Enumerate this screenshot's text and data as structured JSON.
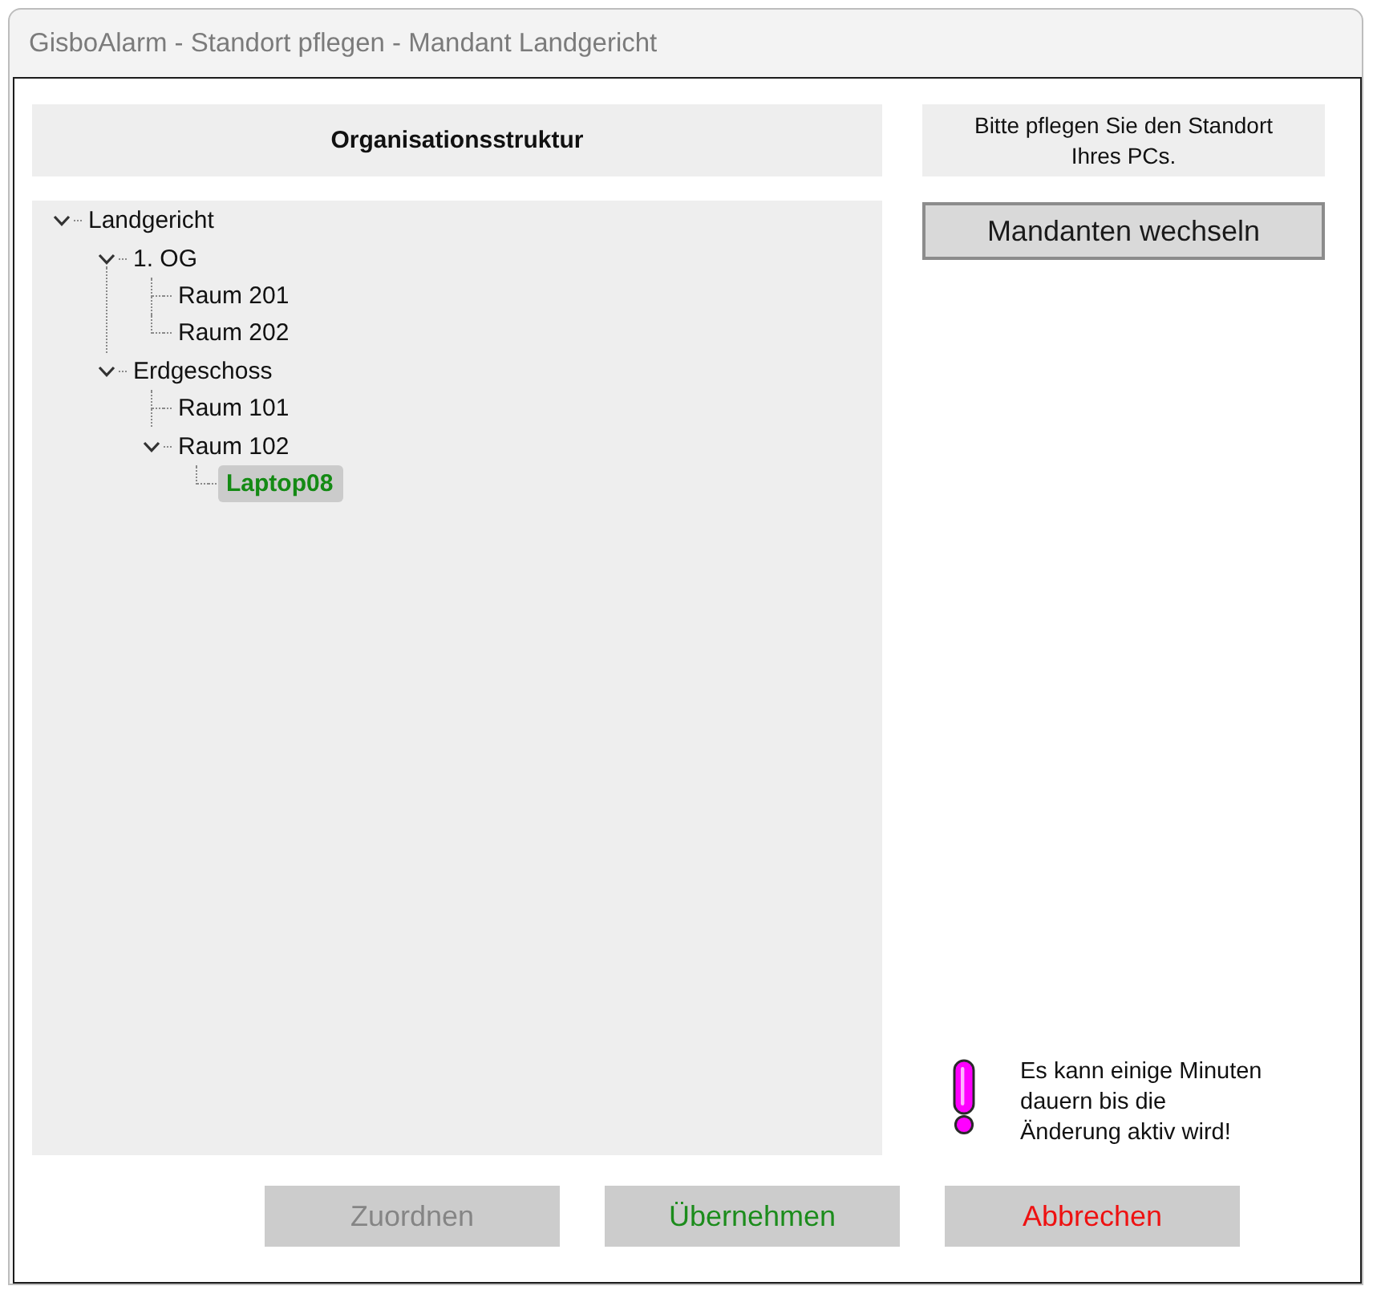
{
  "window": {
    "title": "GisboAlarm - Standort pflegen - Mandant Landgericht"
  },
  "organisation": {
    "heading": "Organisationsstruktur",
    "tree": [
      {
        "label": "Landgericht",
        "expanded": true,
        "selected": false,
        "children": [
          {
            "label": "1. OG",
            "expanded": true,
            "selected": false,
            "children": [
              {
                "label": "Raum 201",
                "selected": false
              },
              {
                "label": "Raum 202",
                "selected": false
              }
            ]
          },
          {
            "label": "Erdgeschoss",
            "expanded": true,
            "selected": false,
            "children": [
              {
                "label": "Raum 101",
                "selected": false
              },
              {
                "label": "Raum 102",
                "expanded": true,
                "selected": false,
                "children": [
                  {
                    "label": "Laptop08",
                    "selected": true
                  }
                ]
              }
            ]
          }
        ]
      }
    ]
  },
  "side": {
    "hint": "Bitte pflegen Sie den Standort\nIhres PCs.",
    "switch_button": "Mandanten wechseln",
    "notice": "Es kann einige Minuten\ndauern bis die\nÄnderung aktiv wird!"
  },
  "buttons": [
    {
      "label": "Zuordnen",
      "kind": "assign",
      "disabled": true
    },
    {
      "label": "Übernehmen",
      "kind": "apply",
      "disabled": false
    },
    {
      "label": "Abbrechen",
      "kind": "cancel",
      "disabled": false
    }
  ]
}
